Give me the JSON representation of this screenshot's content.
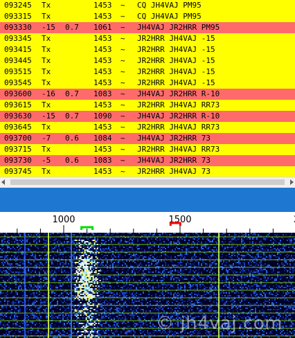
{
  "decodes": [
    {
      "time": "093245",
      "db": "Tx",
      "dt": "",
      "freq": "1453",
      "sep": "~",
      "message": "CQ JH4VAJ PM95",
      "highlight": false
    },
    {
      "time": "093315",
      "db": "Tx",
      "dt": "",
      "freq": "1453",
      "sep": "~",
      "message": "CQ JH4VAJ PM95",
      "highlight": false
    },
    {
      "time": "093330",
      "db": "-15",
      "dt": "0.7",
      "freq": "1061",
      "sep": "~",
      "message": "JH4VAJ JR2HRR PM95",
      "highlight": true
    },
    {
      "time": "093345",
      "db": "Tx",
      "dt": "",
      "freq": "1453",
      "sep": "~",
      "message": "JR2HRR JH4VAJ -15",
      "highlight": false
    },
    {
      "time": "093415",
      "db": "Tx",
      "dt": "",
      "freq": "1453",
      "sep": "~",
      "message": "JR2HRR JH4VAJ -15",
      "highlight": false
    },
    {
      "time": "093445",
      "db": "Tx",
      "dt": "",
      "freq": "1453",
      "sep": "~",
      "message": "JR2HRR JH4VAJ -15",
      "highlight": false
    },
    {
      "time": "093515",
      "db": "Tx",
      "dt": "",
      "freq": "1453",
      "sep": "~",
      "message": "JR2HRR JH4VAJ -15",
      "highlight": false
    },
    {
      "time": "093545",
      "db": "Tx",
      "dt": "",
      "freq": "1453",
      "sep": "~",
      "message": "JR2HRR JH4VAJ -15",
      "highlight": false
    },
    {
      "time": "093600",
      "db": "-16",
      "dt": "0.7",
      "freq": "1083",
      "sep": "~",
      "message": "JH4VAJ JR2HRR R-10",
      "highlight": true
    },
    {
      "time": "093615",
      "db": "Tx",
      "dt": "",
      "freq": "1453",
      "sep": "~",
      "message": "JR2HRR JH4VAJ RR73",
      "highlight": false
    },
    {
      "time": "093630",
      "db": "-15",
      "dt": "0.7",
      "freq": "1090",
      "sep": "~",
      "message": "JH4VAJ JR2HRR R-10",
      "highlight": true
    },
    {
      "time": "093645",
      "db": "Tx",
      "dt": "",
      "freq": "1453",
      "sep": "~",
      "message": "JR2HRR JH4VAJ RR73",
      "highlight": false
    },
    {
      "time": "093700",
      "db": "-7",
      "dt": "0.6",
      "freq": "1084",
      "sep": "~",
      "message": "JH4VAJ JR2HRR 73",
      "highlight": true
    },
    {
      "time": "093715",
      "db": "Tx",
      "dt": "",
      "freq": "1453",
      "sep": "~",
      "message": "JR2HRR JH4VAJ RR73",
      "highlight": false
    },
    {
      "time": "093730",
      "db": "-5",
      "dt": "0.6",
      "freq": "1083",
      "sep": "~",
      "message": "JH4VAJ JR2HRR 73",
      "highlight": true
    },
    {
      "time": "093745",
      "db": "Tx",
      "dt": "",
      "freq": "1453",
      "sep": "~",
      "message": "JR2HRR JH4VAJ 73",
      "highlight": false
    }
  ],
  "colors": {
    "tx_row": "#ffff00",
    "rx_row": "#ff6b6b",
    "blue_band": "#1e78d2",
    "waterfall_bg": "#00002a",
    "rx_marker": "#00dd00",
    "tx_marker": "#ff0000",
    "grid_line": "#9aff00"
  },
  "scale": {
    "labels": [
      "1000",
      "1500",
      "2"
    ],
    "rx_freq_marker": 1100,
    "tx_freq_marker": 1480
  },
  "watermark": "© jh4vaj.com"
}
